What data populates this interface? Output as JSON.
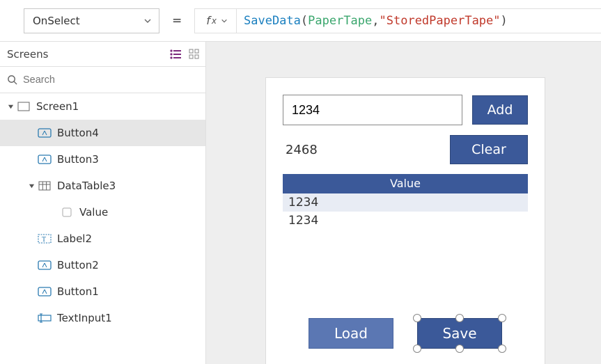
{
  "formulaBar": {
    "property": "OnSelect",
    "tokens": {
      "func": "SaveData",
      "open": "( ",
      "ident": "PaperTape",
      "comma": ", ",
      "str": "\"StoredPaperTape\"",
      "close": " )"
    }
  },
  "sidebar": {
    "title": "Screens",
    "searchPlaceholder": "Search",
    "items": [
      {
        "label": "Screen1"
      },
      {
        "label": "Button4"
      },
      {
        "label": "Button3"
      },
      {
        "label": "DataTable3"
      },
      {
        "label": "Value"
      },
      {
        "label": "Label2"
      },
      {
        "label": "Button2"
      },
      {
        "label": "Button1"
      },
      {
        "label": "TextInput1"
      }
    ]
  },
  "app": {
    "inputValue": "1234",
    "addLabel": "Add",
    "sumValue": "2468",
    "clearLabel": "Clear",
    "tableHeader": "Value",
    "tableRows": [
      "1234",
      "1234"
    ],
    "loadLabel": "Load",
    "saveLabel": "Save"
  }
}
